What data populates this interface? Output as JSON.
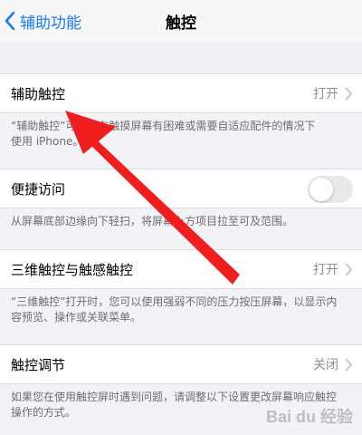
{
  "nav": {
    "back_label": "辅助功能",
    "title": "触控"
  },
  "rows": {
    "assistive_touch": {
      "label": "辅助触控",
      "value": "打开"
    },
    "reachability": {
      "label": "便捷访问",
      "toggle_on": false
    },
    "haptic_touch": {
      "label": "三维触控与触感触控",
      "value": "打开"
    },
    "touch_accommodations": {
      "label": "触控调节",
      "value": "关闭"
    }
  },
  "footers": {
    "assistive_touch_line1": "“辅助触控”可让您在触摸屏幕有困难或需要自适应配件的情况下",
    "assistive_touch_line2": "使用 iPhone。",
    "reachability": "从屏幕底部边缘向下轻扫，将屏幕上方项目拉至可及范围。",
    "haptic_touch_line1": "“三维触控”打开时，您可以使用强弱不同的压力按压屏幕，以显示内",
    "haptic_touch_line2": "容预览、操作或关联菜单。",
    "touch_accommodations_line1": "如果您在使用触控屏时遇到问题，请调整以下设置更改屏幕响应触控",
    "touch_accommodations_line2": "操作的方式。"
  },
  "colors": {
    "accent": "#1a7cf5",
    "annotation_arrow": "#f01e1e",
    "background": "#efeff4"
  },
  "icons": {
    "back": "chevron-left-icon",
    "disclosure": "chevron-right-icon"
  },
  "watermark": "Bai du 经验"
}
